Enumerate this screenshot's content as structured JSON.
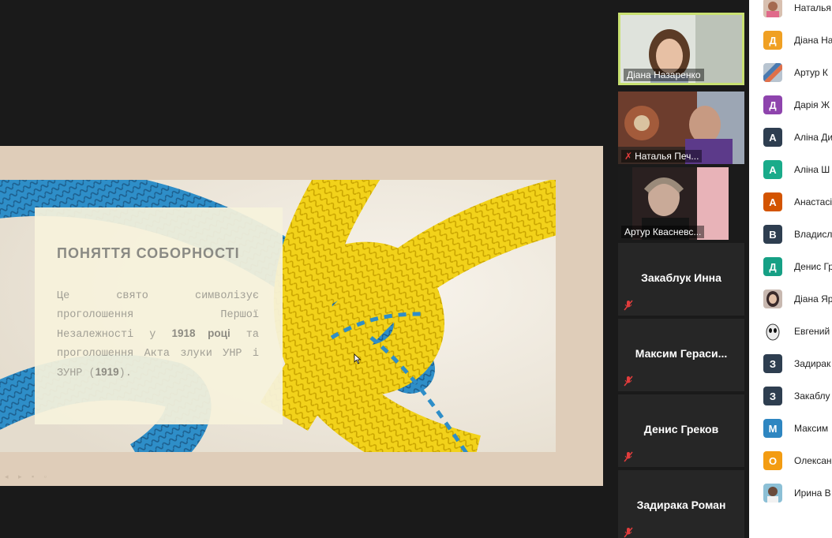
{
  "slide": {
    "title": "ПОНЯТТЯ СОБОРНОСТІ",
    "body_pre": "Це свято символізує проголошення Першої Незалежності у ",
    "body_bold1": "1918 році",
    "body_mid": " та проголошення Акта злуки УНР і ЗУНР (",
    "body_bold2": "1919",
    "body_post": ").",
    "controls": "◂ ▸ ▪ ▫"
  },
  "videos": [
    {
      "name": "Діана Назаренко",
      "muted": false,
      "active": true,
      "photo": true
    },
    {
      "name": "Наталья Печ...",
      "muted": true,
      "active": false,
      "photo": true
    },
    {
      "name": "Артур Квасневс...",
      "muted": false,
      "active": false,
      "photo": true
    },
    {
      "name": "Закаблук Инна",
      "muted": true
    },
    {
      "name": "Максим  Гераси...",
      "muted": true
    },
    {
      "name": "Денис Греков",
      "muted": true
    },
    {
      "name": "Задирака Роман",
      "muted": true
    }
  ],
  "participants": [
    {
      "initial": "",
      "name": "Наталья",
      "color": "#b98a7a",
      "photo": true
    },
    {
      "initial": "Д",
      "name": "Діана На",
      "color": "#f0a023"
    },
    {
      "initial": "",
      "name": "Артур К",
      "color": "#6a7a90",
      "photo": true
    },
    {
      "initial": "Д",
      "name": "Дарія Ж",
      "color": "#8e44ad"
    },
    {
      "initial": "А",
      "name": "Аліна Ди",
      "color": "#2e3e50"
    },
    {
      "initial": "А",
      "name": "Аліна Ш",
      "color": "#1aab8a"
    },
    {
      "initial": "А",
      "name": "Анастасі",
      "color": "#d35400"
    },
    {
      "initial": "В",
      "name": "Владисл",
      "color": "#2e3e50"
    },
    {
      "initial": "Д",
      "name": "Денис Гр",
      "color": "#16a085"
    },
    {
      "initial": "",
      "name": "Діана Яр",
      "color": "#5a4a4a",
      "photo": true
    },
    {
      "initial": "",
      "name": "Евгений",
      "color": "#eeeeee",
      "photo": true
    },
    {
      "initial": "З",
      "name": "Задирак",
      "color": "#2e3e50"
    },
    {
      "initial": "З",
      "name": "Закаблу",
      "color": "#2e3e50"
    },
    {
      "initial": "М",
      "name": "Максим",
      "color": "#2e86c1"
    },
    {
      "initial": "О",
      "name": "Олексан",
      "color": "#f39c12"
    },
    {
      "initial": "",
      "name": "Ирина В",
      "color": "#7ab0c8",
      "photo": true
    }
  ]
}
